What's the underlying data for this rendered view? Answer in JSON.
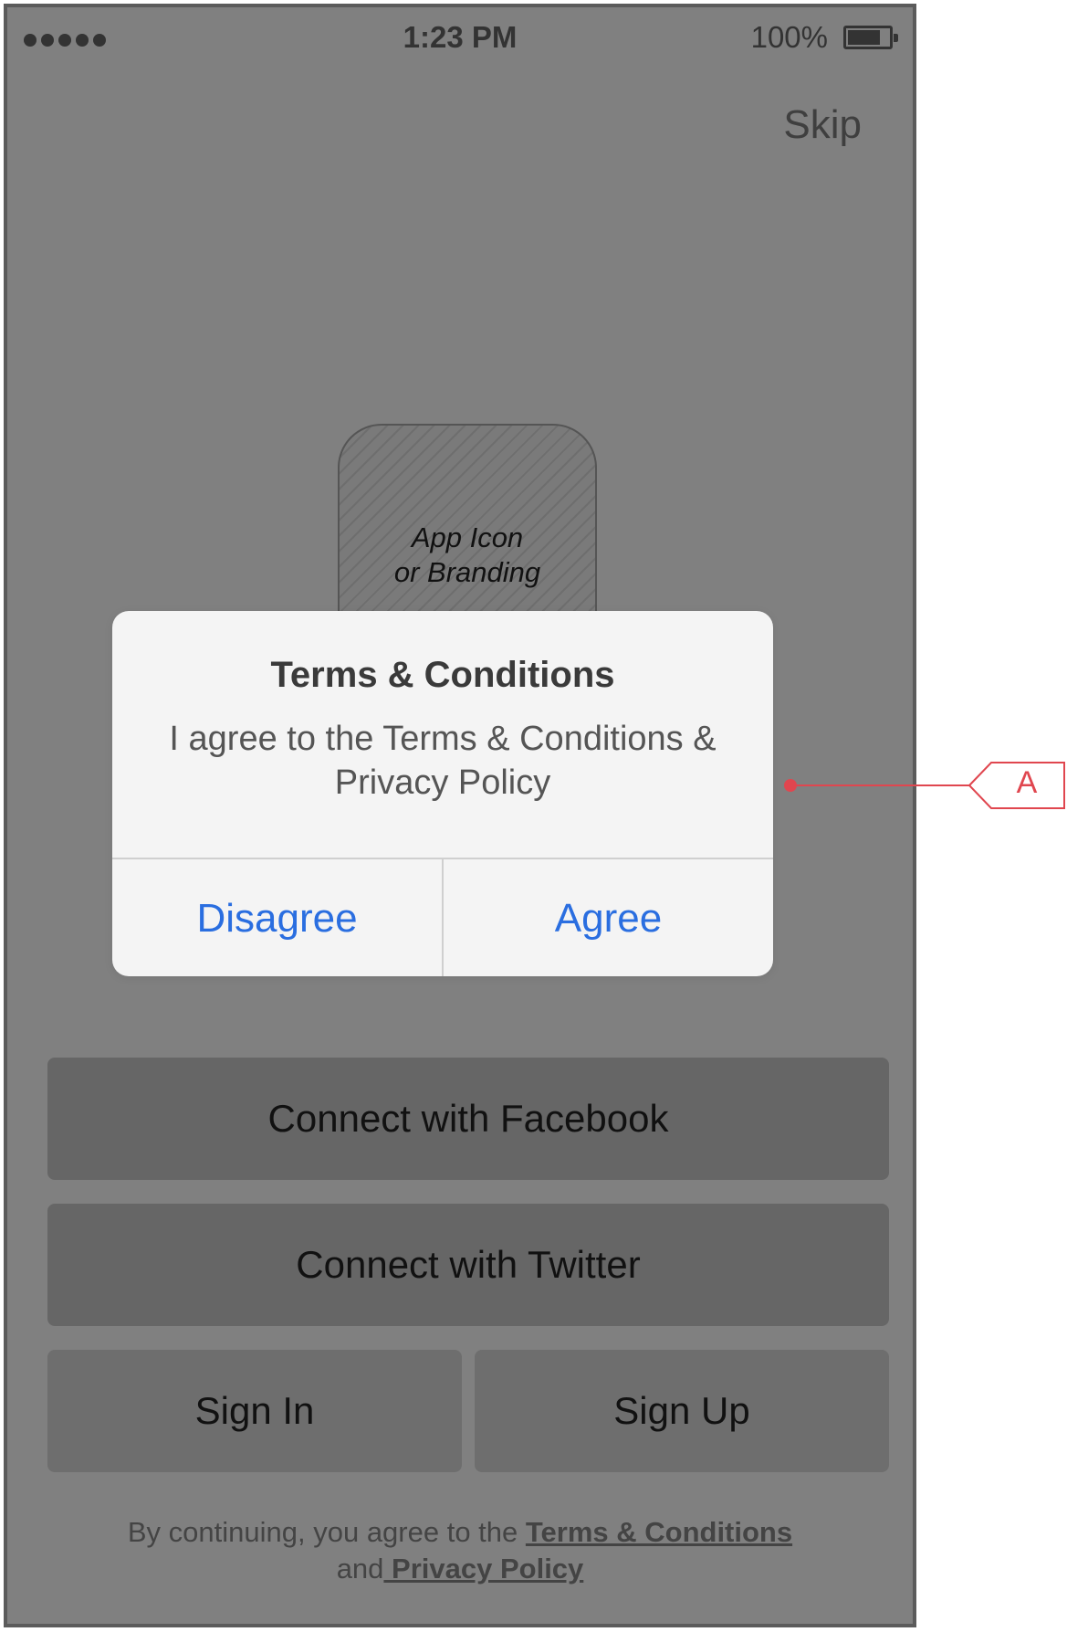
{
  "status_bar": {
    "signal_dots": 5,
    "time": "1:23 PM",
    "battery_percent": "100%",
    "battery_level": 0.8
  },
  "header": {
    "skip_label": "Skip"
  },
  "branding": {
    "placeholder_line1": "App Icon",
    "placeholder_line2": "or Branding"
  },
  "alert": {
    "title": "Terms & Conditions",
    "message": "I agree to the Terms & Conditions & Privacy Policy",
    "disagree_label": "Disagree",
    "agree_label": "Agree",
    "action_color": "#2a6ee0"
  },
  "buttons": {
    "facebook_label": "Connect with Facebook",
    "twitter_label": "Connect with Twitter",
    "sign_in_label": "Sign In",
    "sign_up_label": "Sign Up"
  },
  "footer": {
    "prefix": "By continuing, you agree to the ",
    "terms_link": "Terms & Conditions",
    "and_text": "and",
    "privacy_link": " Privacy Policy"
  },
  "annotation": {
    "label": "A",
    "color": "#e0464f"
  },
  "colors": {
    "screen_bg": "#808080",
    "button_bg": "#666666",
    "alert_bg": "#f4f4f4"
  }
}
